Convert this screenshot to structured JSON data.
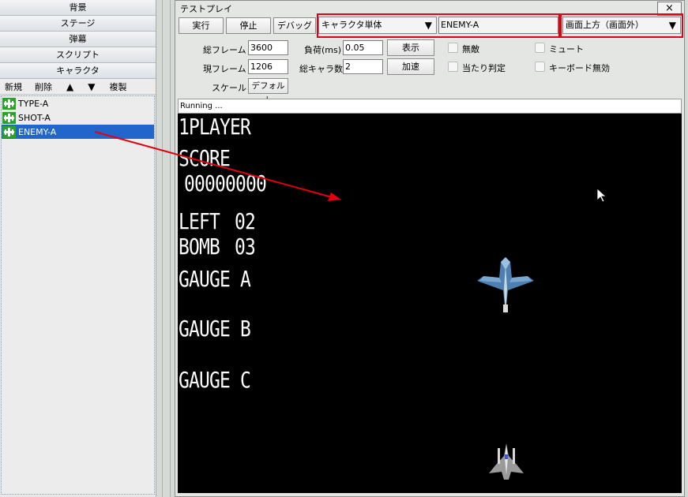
{
  "left_panel": {
    "categories": [
      "背景",
      "ステージ",
      "弾幕",
      "スクリプト",
      "キャラクタ"
    ],
    "toolbar": {
      "new_label": "新規",
      "delete_label": "削除",
      "up_label": "▲",
      "down_label": "▼",
      "duplicate_label": "複製"
    },
    "items": [
      {
        "label": "TYPE-A",
        "selected": false
      },
      {
        "label": "SHOT-A",
        "selected": false
      },
      {
        "label": "ENEMY-A",
        "selected": true
      }
    ]
  },
  "window": {
    "title": "テストプレイ",
    "close_label": "×",
    "run_label": "実行",
    "stop_label": "停止",
    "debug_label": "デバッグ",
    "mode_select": "キャラクタ単体",
    "character_field": "ENEMY-A",
    "position_select": "画面上方（画面外）",
    "total_frames_label": "総フレーム",
    "total_frames": "3600",
    "current_frame_label": "現フレーム",
    "current_frame": "1206",
    "load_label": "負荷(ms)",
    "load_value": "0.05",
    "total_chars_label": "総キャラ数",
    "total_chars": "2",
    "display_button": "表示",
    "accelerate_button": "加速",
    "scale_label": "スケール",
    "scale_value": "デフォルト",
    "invincible_label": "無敵",
    "hit_label": "当たり判定",
    "mute_label": "ミュート",
    "keyboard_disable_label": "キーボード無効",
    "status": "Running ..."
  },
  "game": {
    "player_label": "1PLAYER",
    "score_label": "SCORE",
    "score": "00000000",
    "left_label": "LEFT",
    "left_value": "02",
    "bomb_label": "BOMB",
    "bomb_value": "03",
    "gauge_a": "GAUGE A",
    "gauge_b": "GAUGE B",
    "gauge_c": "GAUGE C"
  },
  "colors": {
    "selection": "#2266cc",
    "highlight": "#e00010",
    "icon_green": "#2aa32a"
  }
}
